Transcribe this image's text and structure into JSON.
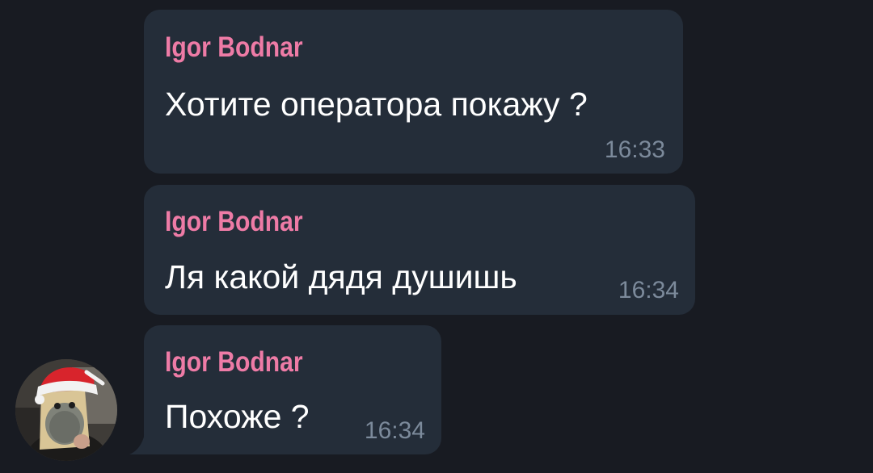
{
  "messages": [
    {
      "sender": "Igor Bodnar",
      "text": "Хотите оператора покажу ?",
      "time": "16:33"
    },
    {
      "sender": "Igor Bodnar",
      "text": "Ля какой дядя душишь",
      "time": "16:34"
    },
    {
      "sender": "Igor Bodnar",
      "text": "Похоже ?",
      "time": "16:34"
    }
  ],
  "avatar": {
    "icon": "santa-hat-avatar"
  },
  "colors": {
    "background": "#181b22",
    "bubble": "#242d39",
    "sender": "#ee7ba6",
    "text": "#ffffff",
    "time": "#7c8a9b"
  }
}
